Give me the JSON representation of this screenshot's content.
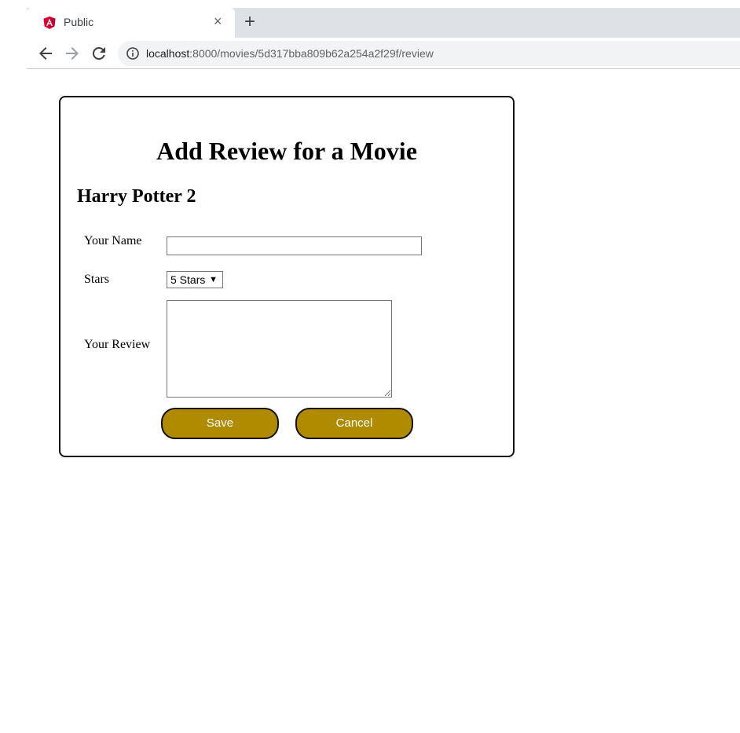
{
  "browser": {
    "tab_title": "Public",
    "close_glyph": "×",
    "newtab_glyph": "+",
    "url_host": "localhost",
    "url_rest": ":8000/movies/5d317bba809b62a254a2f29f/review",
    "favicon_color": "#dd0031"
  },
  "form": {
    "page_title": "Add Review for a Movie",
    "movie_title": "Harry Potter 2",
    "name_label": "Your Name",
    "name_value": "",
    "stars_label": "Stars",
    "stars_selected": "5 Stars",
    "review_label": "Your Review",
    "review_value": "",
    "save_label": "Save",
    "cancel_label": "Cancel",
    "button_color": "#b08b00"
  }
}
